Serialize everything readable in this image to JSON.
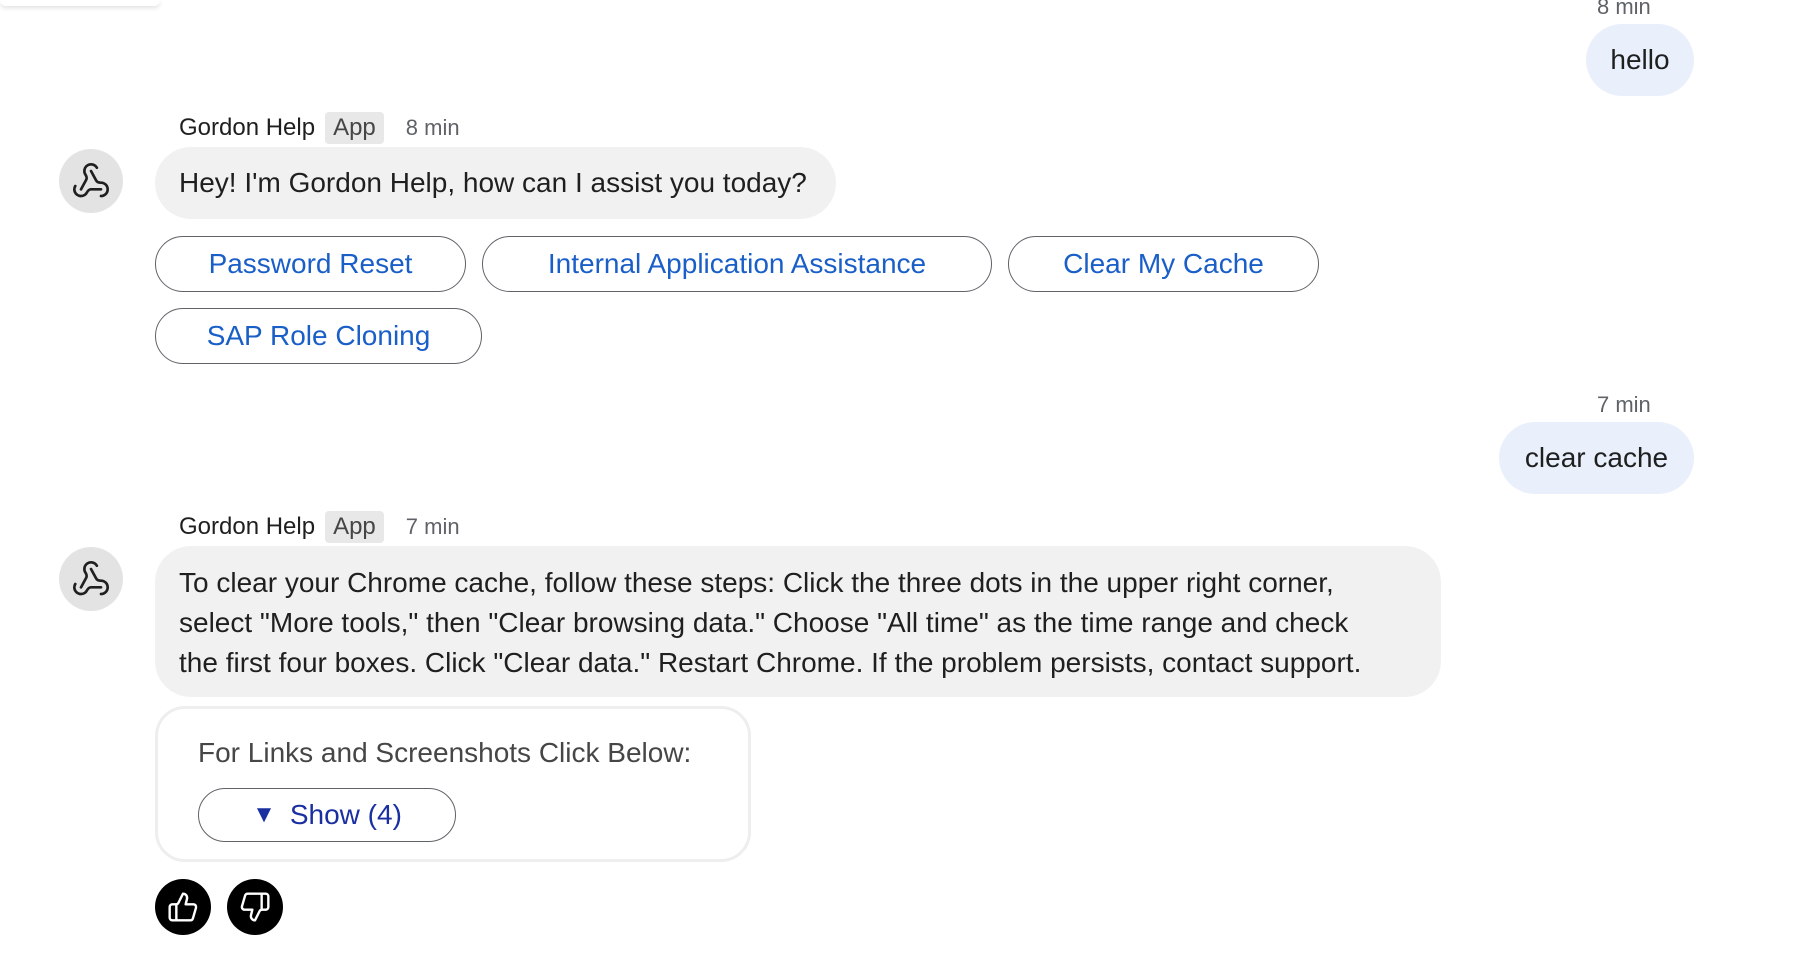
{
  "messages": {
    "user1": {
      "time": "8 min",
      "text": "hello"
    },
    "bot1": {
      "sender": "Gordon Help",
      "tag": "App",
      "time": "8 min",
      "text": "Hey! I'm Gordon Help, how can I assist you today?",
      "chips": [
        "Password Reset",
        "Internal Application Assistance",
        "Clear My Cache",
        "SAP Role Cloning"
      ]
    },
    "user2": {
      "time": "7 min",
      "text": "clear cache"
    },
    "bot2": {
      "sender": "Gordon Help",
      "tag": "App",
      "time": "7 min",
      "lines": [
        "To clear your Chrome cache, follow these steps: Click the three dots in the upper right corner,",
        "select \"More tools,\" then \"Clear browsing data.\" Choose \"All time\" as the time range and check",
        "the first four boxes. Click \"Clear data.\" Restart Chrome. If the problem persists, contact support."
      ],
      "links_card": {
        "title": "For Links and Screenshots Click Below:",
        "toggle_icon": "▼",
        "show_label": "Show (4)"
      }
    }
  },
  "feedback": {
    "thumbs_up_icon": "thumbs-up-icon",
    "thumbs_down_icon": "thumbs-down-icon"
  },
  "colors": {
    "user_bubble": "#e9f0fb",
    "bot_bubble": "#f1f1f1",
    "chip_text": "#1a5fc8",
    "show_text": "#1a2fa0"
  }
}
